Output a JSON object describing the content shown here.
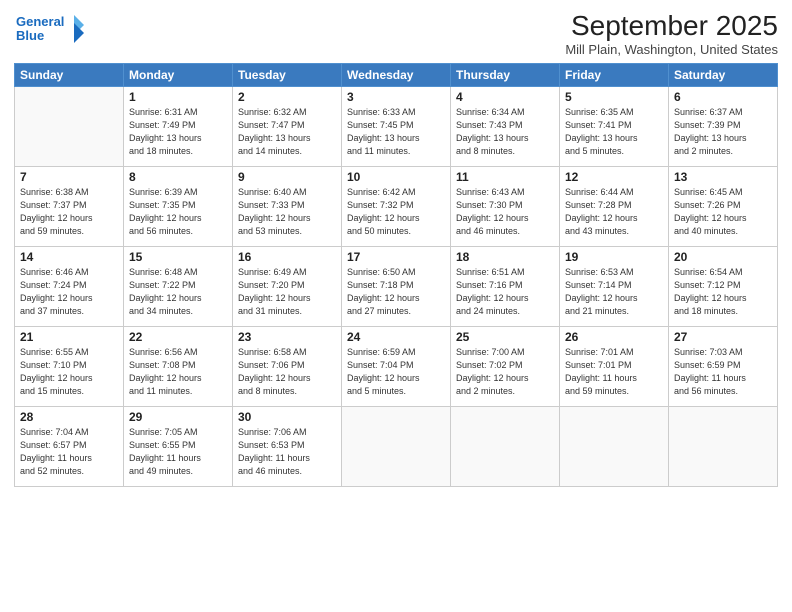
{
  "header": {
    "logo_line1": "General",
    "logo_line2": "Blue",
    "title": "September 2025",
    "subtitle": "Mill Plain, Washington, United States"
  },
  "weekdays": [
    "Sunday",
    "Monday",
    "Tuesday",
    "Wednesday",
    "Thursday",
    "Friday",
    "Saturday"
  ],
  "weeks": [
    [
      {
        "day": "",
        "info": ""
      },
      {
        "day": "1",
        "info": "Sunrise: 6:31 AM\nSunset: 7:49 PM\nDaylight: 13 hours\nand 18 minutes."
      },
      {
        "day": "2",
        "info": "Sunrise: 6:32 AM\nSunset: 7:47 PM\nDaylight: 13 hours\nand 14 minutes."
      },
      {
        "day": "3",
        "info": "Sunrise: 6:33 AM\nSunset: 7:45 PM\nDaylight: 13 hours\nand 11 minutes."
      },
      {
        "day": "4",
        "info": "Sunrise: 6:34 AM\nSunset: 7:43 PM\nDaylight: 13 hours\nand 8 minutes."
      },
      {
        "day": "5",
        "info": "Sunrise: 6:35 AM\nSunset: 7:41 PM\nDaylight: 13 hours\nand 5 minutes."
      },
      {
        "day": "6",
        "info": "Sunrise: 6:37 AM\nSunset: 7:39 PM\nDaylight: 13 hours\nand 2 minutes."
      }
    ],
    [
      {
        "day": "7",
        "info": "Sunrise: 6:38 AM\nSunset: 7:37 PM\nDaylight: 12 hours\nand 59 minutes."
      },
      {
        "day": "8",
        "info": "Sunrise: 6:39 AM\nSunset: 7:35 PM\nDaylight: 12 hours\nand 56 minutes."
      },
      {
        "day": "9",
        "info": "Sunrise: 6:40 AM\nSunset: 7:33 PM\nDaylight: 12 hours\nand 53 minutes."
      },
      {
        "day": "10",
        "info": "Sunrise: 6:42 AM\nSunset: 7:32 PM\nDaylight: 12 hours\nand 50 minutes."
      },
      {
        "day": "11",
        "info": "Sunrise: 6:43 AM\nSunset: 7:30 PM\nDaylight: 12 hours\nand 46 minutes."
      },
      {
        "day": "12",
        "info": "Sunrise: 6:44 AM\nSunset: 7:28 PM\nDaylight: 12 hours\nand 43 minutes."
      },
      {
        "day": "13",
        "info": "Sunrise: 6:45 AM\nSunset: 7:26 PM\nDaylight: 12 hours\nand 40 minutes."
      }
    ],
    [
      {
        "day": "14",
        "info": "Sunrise: 6:46 AM\nSunset: 7:24 PM\nDaylight: 12 hours\nand 37 minutes."
      },
      {
        "day": "15",
        "info": "Sunrise: 6:48 AM\nSunset: 7:22 PM\nDaylight: 12 hours\nand 34 minutes."
      },
      {
        "day": "16",
        "info": "Sunrise: 6:49 AM\nSunset: 7:20 PM\nDaylight: 12 hours\nand 31 minutes."
      },
      {
        "day": "17",
        "info": "Sunrise: 6:50 AM\nSunset: 7:18 PM\nDaylight: 12 hours\nand 27 minutes."
      },
      {
        "day": "18",
        "info": "Sunrise: 6:51 AM\nSunset: 7:16 PM\nDaylight: 12 hours\nand 24 minutes."
      },
      {
        "day": "19",
        "info": "Sunrise: 6:53 AM\nSunset: 7:14 PM\nDaylight: 12 hours\nand 21 minutes."
      },
      {
        "day": "20",
        "info": "Sunrise: 6:54 AM\nSunset: 7:12 PM\nDaylight: 12 hours\nand 18 minutes."
      }
    ],
    [
      {
        "day": "21",
        "info": "Sunrise: 6:55 AM\nSunset: 7:10 PM\nDaylight: 12 hours\nand 15 minutes."
      },
      {
        "day": "22",
        "info": "Sunrise: 6:56 AM\nSunset: 7:08 PM\nDaylight: 12 hours\nand 11 minutes."
      },
      {
        "day": "23",
        "info": "Sunrise: 6:58 AM\nSunset: 7:06 PM\nDaylight: 12 hours\nand 8 minutes."
      },
      {
        "day": "24",
        "info": "Sunrise: 6:59 AM\nSunset: 7:04 PM\nDaylight: 12 hours\nand 5 minutes."
      },
      {
        "day": "25",
        "info": "Sunrise: 7:00 AM\nSunset: 7:02 PM\nDaylight: 12 hours\nand 2 minutes."
      },
      {
        "day": "26",
        "info": "Sunrise: 7:01 AM\nSunset: 7:01 PM\nDaylight: 11 hours\nand 59 minutes."
      },
      {
        "day": "27",
        "info": "Sunrise: 7:03 AM\nSunset: 6:59 PM\nDaylight: 11 hours\nand 56 minutes."
      }
    ],
    [
      {
        "day": "28",
        "info": "Sunrise: 7:04 AM\nSunset: 6:57 PM\nDaylight: 11 hours\nand 52 minutes."
      },
      {
        "day": "29",
        "info": "Sunrise: 7:05 AM\nSunset: 6:55 PM\nDaylight: 11 hours\nand 49 minutes."
      },
      {
        "day": "30",
        "info": "Sunrise: 7:06 AM\nSunset: 6:53 PM\nDaylight: 11 hours\nand 46 minutes."
      },
      {
        "day": "",
        "info": ""
      },
      {
        "day": "",
        "info": ""
      },
      {
        "day": "",
        "info": ""
      },
      {
        "day": "",
        "info": ""
      }
    ]
  ]
}
